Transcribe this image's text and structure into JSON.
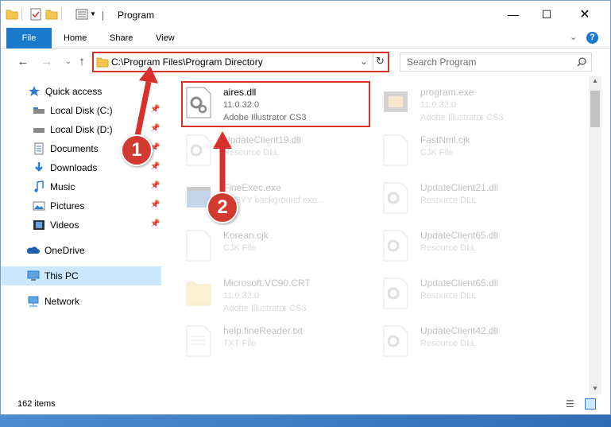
{
  "window": {
    "title": "Program"
  },
  "ribbon": {
    "tabs": [
      "File",
      "Home",
      "Share",
      "View"
    ]
  },
  "address": {
    "path": "C:\\Program Files\\Program Directory",
    "search_placeholder": "Search Program"
  },
  "sidebar": {
    "items": [
      {
        "label": "Quick access",
        "icon": "star-icon"
      },
      {
        "label": "Local Disk (C:)",
        "icon": "drive-icon"
      },
      {
        "label": "Local Disk (D:)",
        "icon": "drive-icon"
      },
      {
        "label": "Documents",
        "icon": "documents-icon"
      },
      {
        "label": "Downloads",
        "icon": "downloads-icon"
      },
      {
        "label": "Music",
        "icon": "music-icon"
      },
      {
        "label": "Pictures",
        "icon": "pictures-icon"
      },
      {
        "label": "Videos",
        "icon": "videos-icon"
      },
      {
        "label": "OneDrive",
        "icon": "onedrive-icon"
      },
      {
        "label": "This PC",
        "icon": "pc-icon"
      },
      {
        "label": "Network",
        "icon": "network-icon"
      }
    ]
  },
  "files": [
    {
      "name": "aires.dll",
      "line2": "11.0.32.0",
      "line3": "Adobe Illustrator CS3"
    },
    {
      "name": "program.exe",
      "line2": "11.0.32.0",
      "line3": "Adobe Illustrator CS3"
    },
    {
      "name": "UpdateClient19.dll",
      "line2": "Resource DLL",
      "line3": ""
    },
    {
      "name": "FastNml.cjk",
      "line2": "CJK File",
      "line3": ""
    },
    {
      "name": "FineExec.exe",
      "line2": "ABBYY background exe...",
      "line3": ""
    },
    {
      "name": "UpdateClient21.dll",
      "line2": "Resource DLL",
      "line3": ""
    },
    {
      "name": "Korean.cjk",
      "line2": "CJK File",
      "line3": ""
    },
    {
      "name": "UpdateClient65.dll",
      "line2": "Resource DLL",
      "line3": ""
    },
    {
      "name": "Microsoft.VC90.CRT",
      "line2": "11.0.32.0",
      "line3": "Adobe Illustrator CS3"
    },
    {
      "name": "UpdateClient65.dll",
      "line2": "Resource DLL",
      "line3": ""
    },
    {
      "name": "help.fineReader.txt",
      "line2": "TXT File",
      "line3": ""
    },
    {
      "name": "UpdateClient42.dll",
      "line2": "Resource DLL",
      "line3": ""
    }
  ],
  "status": {
    "count": "162 items"
  },
  "annotations": {
    "step1": "1",
    "step2": "2",
    "color": "#d9302c"
  }
}
